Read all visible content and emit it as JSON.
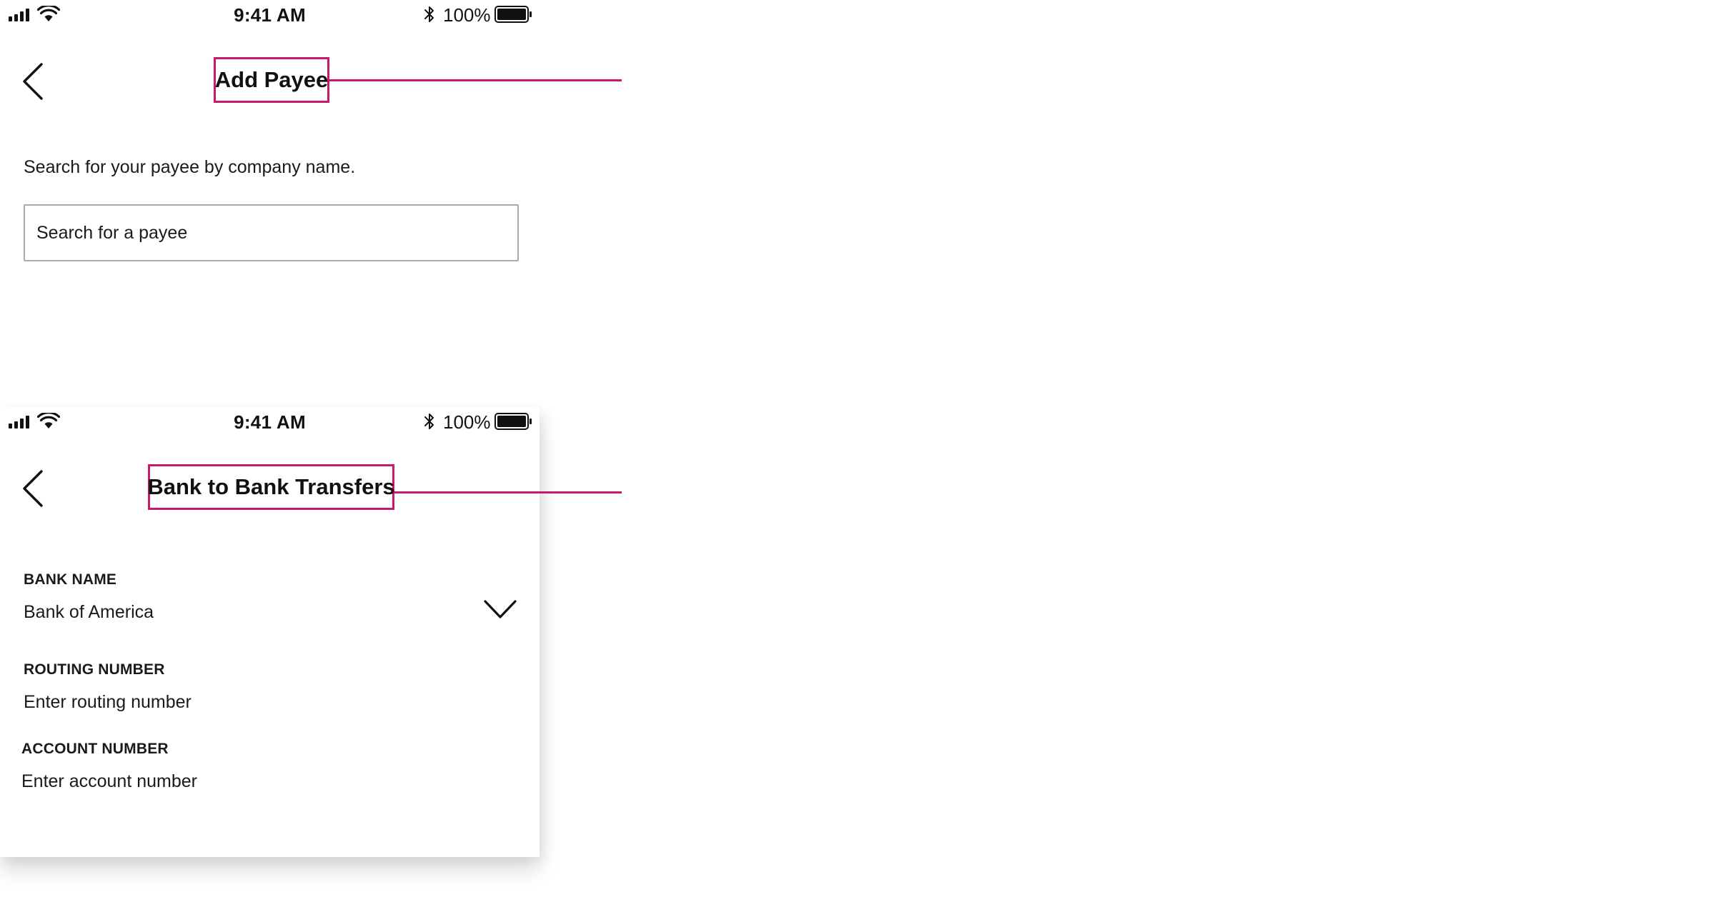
{
  "accent_color": "#c8196e",
  "screens": [
    {
      "status_bar": {
        "time": "9:41 AM",
        "battery_percent": "100%",
        "icons": [
          "signal-icon",
          "wifi-icon",
          "bluetooth-icon",
          "battery-icon"
        ]
      },
      "header": {
        "back_icon": "back-icon",
        "title": "Add Payee"
      },
      "instruction": "Search for your payee by company name.",
      "search": {
        "placeholder": "Search for a payee"
      }
    },
    {
      "status_bar": {
        "time": "9:41 AM",
        "battery_percent": "100%",
        "icons": [
          "signal-icon",
          "wifi-icon",
          "bluetooth-icon",
          "battery-icon"
        ]
      },
      "header": {
        "back_icon": "back-icon",
        "title": "Bank to Bank Transfers"
      },
      "form": {
        "bank_name": {
          "label": "BANK NAME",
          "value": "Bank of America",
          "icon": "chevron-down-icon"
        },
        "routing_number": {
          "label": "ROUTING NUMBER",
          "placeholder": "Enter routing number"
        },
        "account_number": {
          "label": "ACCOUNT NUMBER",
          "placeholder": "Enter account number"
        }
      }
    }
  ]
}
